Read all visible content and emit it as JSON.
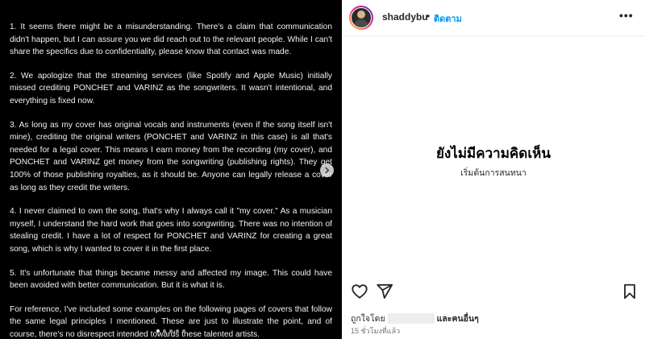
{
  "post": {
    "paragraphs": [
      "1. It seems there might be a misunderstanding. There's a claim that communication didn't happen, but I can assure you we did reach out to the relevant people. While I can't share the specifics due to confidentiality, please know that contact was made.",
      "2. We apologize that the streaming services (like Spotify and Apple Music) initially missed crediting PONCHET and VARINZ as the songwriters. It wasn't intentional, and everything is fixed now.",
      "3. As long as my cover has original vocals and instruments (even if the song itself isn't mine), crediting the original writers (PONCHET and VARINZ in this case) is all that's needed for a legal cover. This means I earn money from the recording (my cover), and PONCHET and VARINZ get money from the songwriting (publishing rights). They get 100% of those publishing royalties, as it should be. Anyone can legally release a cover as long as they credit the writers.",
      "4. I never claimed to own the song, that's why I always call it \"my cover.\" As a musician myself, I understand the hard work that goes into songwriting. There was no intention of stealing credit. I have a lot of respect for PONCHET and VARINZ for creating a great song, which is why I wanted to cover it in the first place.",
      "5. It's unfortunate that things became messy and affected my image. This could have been avoided with better communication. But it is what it is.",
      "For reference, I've included some examples on the following pages of covers that follow the same legal principles I mentioned. These are just to illustrate the point, and of course, there's no disrespect intended towards these talented artists."
    ],
    "carousel": {
      "total": 5,
      "active_index": 0
    }
  },
  "header": {
    "username": "shaddybu",
    "separator": "•",
    "follow_label": "ติดตาม",
    "more_label": "•••"
  },
  "comments": {
    "empty_title": "ยังไม่มีความคิดเห็น",
    "empty_subtitle": "เริ่มต้นการสนทนา"
  },
  "footer": {
    "liked_by_prefix": "ถูกใจโดย",
    "liked_by_suffix": "และคนอื่นๆ",
    "timestamp": "15 ชั่วโมงที่แล้ว"
  },
  "icons": {
    "like": "heart-icon",
    "share": "paper-plane-icon",
    "save": "bookmark-icon",
    "next": "chevron-right-icon"
  },
  "colors": {
    "follow": "#0095f6",
    "post_bg": "#000000"
  }
}
